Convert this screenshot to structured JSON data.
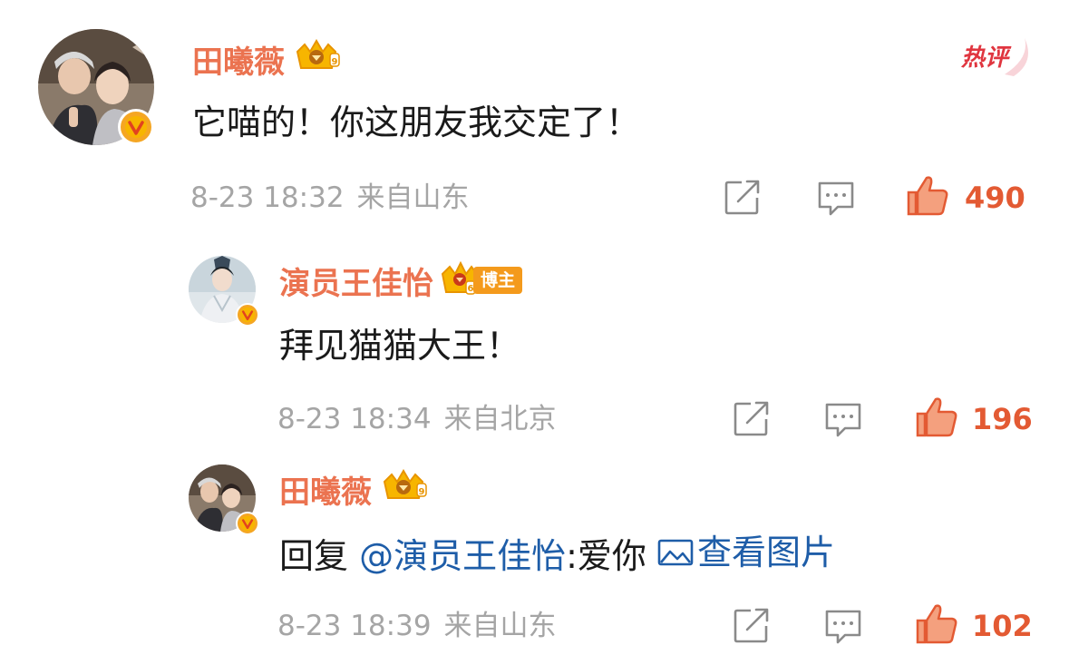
{
  "hot_tag": "热评",
  "comments": [
    {
      "user": "田曦薇",
      "text": "它喵的！你这朋友我交定了！",
      "date": "8-23 18:32",
      "location": "来自山东",
      "likes": "490"
    },
    {
      "user": "演员王佳怡",
      "badge": "博主",
      "text": "拜见猫猫大王！",
      "date": "8-23 18:34",
      "location": "来自北京",
      "likes": "196"
    },
    {
      "user": "田曦薇",
      "reply_prefix": "回复 ",
      "mention": "@演员王佳怡",
      "reply_text": ":爱你 ",
      "picture_link": "查看图片",
      "date": "8-23 18:39",
      "location": "来自山东",
      "likes": "102"
    }
  ],
  "colors": {
    "username": "#eb7350",
    "like": "#e35a33",
    "meta": "#a5a5a5",
    "link": "#1e5da8"
  }
}
